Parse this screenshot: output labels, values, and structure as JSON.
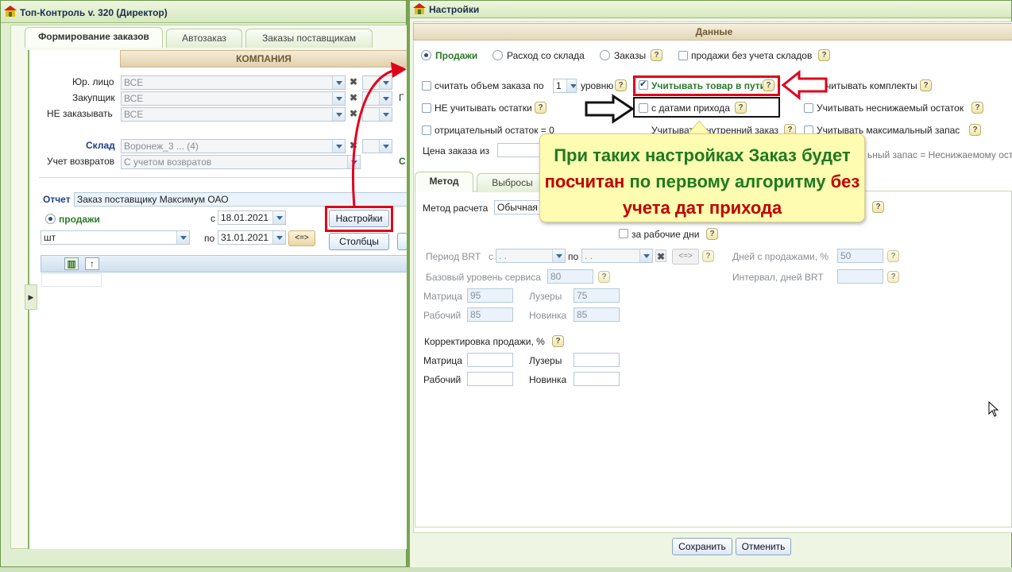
{
  "left_window": {
    "title": "Топ-Контроль v. 320 (Директор)",
    "tabs": [
      "Формирование заказов",
      "Автозаказ",
      "Заказы поставщикам"
    ],
    "company_header": "КОМПАНИЯ",
    "filters": {
      "legal_label": "Юр. лицо",
      "legal_value": "ВСЕ",
      "buyer_label": "Закупщик",
      "buyer_value": "ВСЕ",
      "exclude_label": "НЕ заказывать",
      "exclude_value": "ВСЕ",
      "warehouse_label": "Склад",
      "warehouse_value": "Воронеж_3 ... (4)",
      "returns_label": "Учет возвратов",
      "returns_value": "С учетом возвратов",
      "partial_label": "Г",
      "partial_label2": "С"
    },
    "report_label": "Отчет",
    "report_value": "Заказ поставщику Максимум ОАО",
    "sales_radio_label": "продажи",
    "unit_value": "шт",
    "from_label": "с",
    "from_date": "18.01.2021",
    "to_label": "по",
    "to_date": "31.01.2021",
    "swap_label": "<=>",
    "settings_button": "Настройки",
    "columns_button": "Столбцы",
    "grid_up_icon": "↑"
  },
  "dialog": {
    "title": "Настройки",
    "section_header": "Данные",
    "mode_sales": "Продажи",
    "mode_outflow": "Расход со склада",
    "mode_orders": "Заказы",
    "no_warehouse_label": "продажи без учета складов",
    "count_volume_label": "считать объем заказа по",
    "level_value": "1",
    "level_label": "уровню",
    "transit_label": "Учитывать товар в пути",
    "kits_label": "читывать комплекты",
    "ignore_stock_label": "НЕ учитывать остатки",
    "arrival_dates_label": "с датами прихода",
    "min_stock_label": "Учитывать неснижаемый остаток",
    "negative_stock_label": "отрицательный остаток = 0",
    "internal_order_label": "Учитывать внутренний заказ",
    "max_stock_label": "Учитывать максимальный запас",
    "price_label": "Цена заказа из",
    "max_eq_min_label": "ьный запас = Неснижаемому ост",
    "tabs": [
      "Метод",
      "Выбросы"
    ],
    "method_label": "Метод расчета",
    "method_value": "Обычная",
    "workdays_label": "за рабочие дни",
    "brt_period_label": "Период BRT",
    "brt_from": "с",
    "brt_to": "по",
    "brt_from_value": "  .  .",
    "brt_to_value": "  .  .",
    "brt_swap": "<=>",
    "sales_days_label": "Дней с продажами, %",
    "sales_days_value": "50",
    "service_label": "Базовый уровень сервиса",
    "service_value": "80",
    "brt_interval_label": "Интервал, дней BRT",
    "matrix_label": "Матрица",
    "matrix_value": "95",
    "losers_label": "Лузеры",
    "losers_value": "75",
    "working_label": "Рабочий",
    "working_value": "85",
    "new_label": "Новинка",
    "new_value": "85",
    "correction_label": "Корректировка продажи, %",
    "corr_matrix_label": "Матрица",
    "corr_losers_label": "Лузеры",
    "corr_working_label": "Рабочий",
    "corr_new_label": "Новинка",
    "save_button": "Сохранить",
    "cancel_button": "Отменить",
    "help_glyph": "?"
  },
  "callout": {
    "part1": "При таких настройках Заказ будет ",
    "part2": "посчитан",
    "part3": " по первому алгоритму ",
    "part4": "без учета дат прихода"
  },
  "colors": {
    "annotation_red": "#e0001b",
    "callout_green": "#1f7a1f",
    "callout_red": "#c00000"
  }
}
